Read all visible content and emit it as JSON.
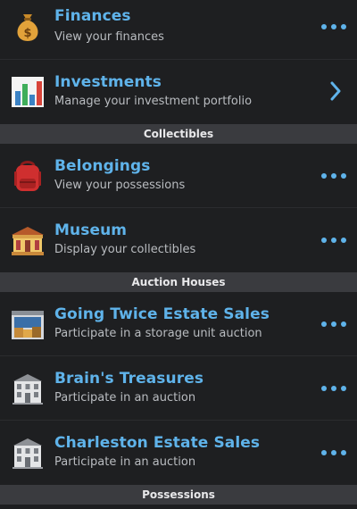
{
  "rows_top": [
    {
      "title": "Finances",
      "subtitle": "View your finances",
      "icon": "money-bag-icon",
      "action": "more-icon"
    },
    {
      "title": "Investments",
      "subtitle": "Manage your investment portfolio",
      "icon": "bar-chart-icon",
      "action": "chevron-right-icon"
    }
  ],
  "sections": {
    "collectibles": "Collectibles",
    "auction_houses": "Auction Houses",
    "possessions": "Possessions"
  },
  "rows_collectibles": [
    {
      "title": "Belongings",
      "subtitle": "View your possessions",
      "icon": "backpack-icon",
      "action": "more-icon"
    },
    {
      "title": "Museum",
      "subtitle": "Display your collectibles",
      "icon": "museum-building-icon",
      "action": "more-icon"
    }
  ],
  "rows_auctions": [
    {
      "title": "Going Twice Estate Sales",
      "subtitle": "Participate in a storage unit auction",
      "icon": "storage-unit-icon",
      "action": "more-icon"
    },
    {
      "title": "Brain's Treasures",
      "subtitle": "Participate in an auction",
      "icon": "auction-house-icon",
      "action": "more-icon"
    },
    {
      "title": "Charleston Estate Sales",
      "subtitle": "Participate in an auction",
      "icon": "auction-house-icon",
      "action": "more-icon"
    }
  ],
  "colors": {
    "accent": "#5fb3ea",
    "background": "#1e1f21",
    "section_header": "#3a3b3f"
  }
}
